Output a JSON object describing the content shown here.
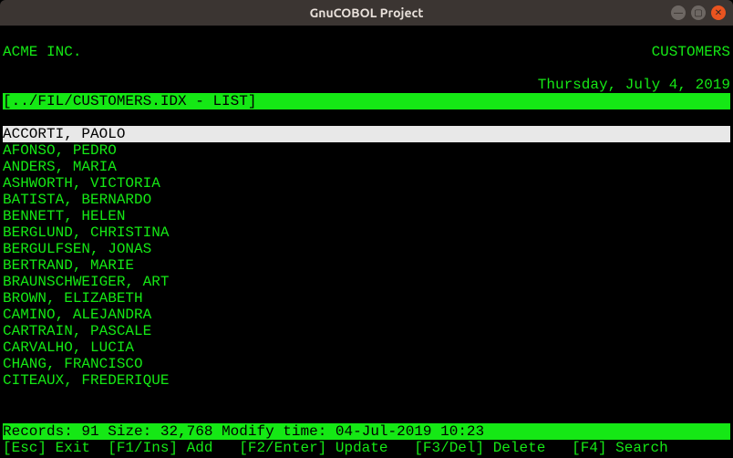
{
  "window": {
    "title": "GnuCOBOL Project"
  },
  "header": {
    "company": "ACME INC.",
    "module": "CUSTOMERS",
    "date": "Thursday, July 4, 2019"
  },
  "location": "[../FIL/CUSTOMERS.IDX - LIST]",
  "list": {
    "selected_index": 0,
    "items": [
      "ACCORTI, PAOLO",
      "AFONSO, PEDRO",
      "ANDERS, MARIA",
      "ASHWORTH, VICTORIA",
      "BATISTA, BERNARDO",
      "BENNETT, HELEN",
      "BERGLUND, CHRISTINA",
      "BERGULFSEN, JONAS",
      "BERTRAND, MARIE",
      "BRAUNSCHWEIGER, ART",
      "BROWN, ELIZABETH",
      "CAMINO, ALEJANDRA",
      "CARTRAIN, PASCALE",
      "CARVALHO, LUCIA",
      "CHANG, FRANCISCO",
      "CITEAUX, FREDERIQUE"
    ]
  },
  "status": {
    "records_label": "Records:",
    "records": "91",
    "size_label": "Size:",
    "size": "32,768",
    "modify_label": "Modify time:",
    "modify": "04-Jul-2019 10:23"
  },
  "fnkeys": [
    {
      "key": "[Esc]",
      "label": "Exit"
    },
    {
      "key": "[F1/Ins]",
      "label": "Add"
    },
    {
      "key": "[F2/Enter]",
      "label": "Update"
    },
    {
      "key": "[F3/Del]",
      "label": "Delete"
    },
    {
      "key": "[F4]",
      "label": "Search"
    }
  ]
}
